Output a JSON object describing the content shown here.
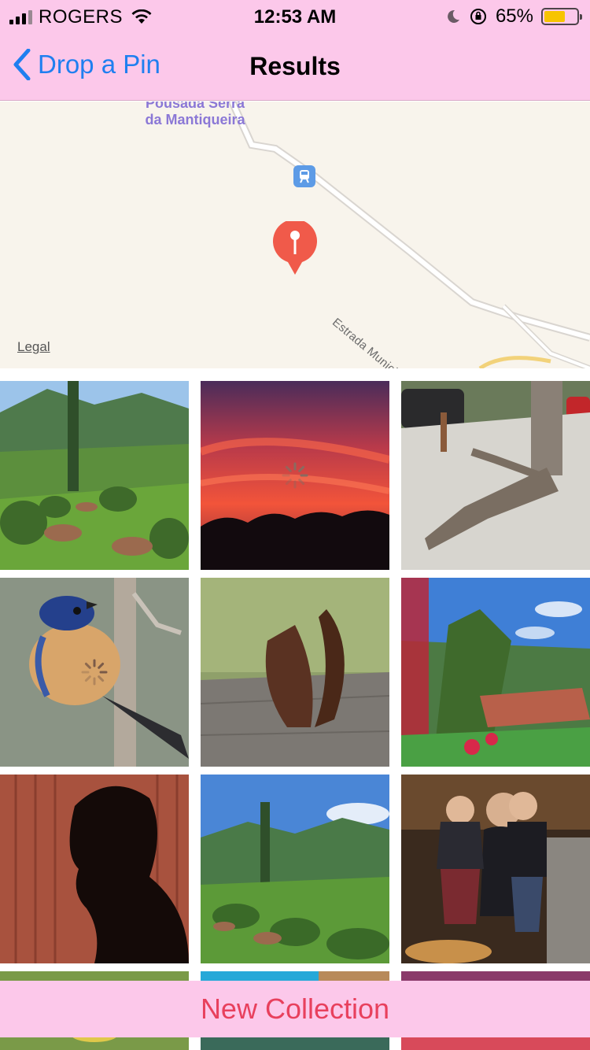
{
  "status_bar": {
    "carrier": "ROGERS",
    "time": "12:53 AM",
    "battery_percent": "65%",
    "battery_level": 0.65,
    "icons": [
      "signal-icon",
      "wifi-icon",
      "moon-icon",
      "orientation-lock-icon",
      "battery-icon"
    ]
  },
  "nav": {
    "back_label": "Drop a Pin",
    "title": "Results"
  },
  "map": {
    "poi_label": "Pousada Serra da Mantiqueira",
    "street_label": "Estrada Municipal João Jorge Saad",
    "legal_label": "Legal",
    "pin_color": "#f05a4a"
  },
  "photos": [
    {
      "subject": "mountain garden with fountains",
      "loading": false
    },
    {
      "subject": "red sunset silhouette",
      "loading": true
    },
    {
      "subject": "tree roots on sidewalk",
      "loading": false
    },
    {
      "subject": "bird on branch",
      "loading": true
    },
    {
      "subject": "dried leaf on wood",
      "loading": false
    },
    {
      "subject": "hillside with flowers and chalet",
      "loading": false
    },
    {
      "subject": "profile silhouette on curtain",
      "loading": false
    },
    {
      "subject": "garden with cypress tree",
      "loading": false
    },
    {
      "subject": "woman holding two children",
      "loading": false
    }
  ],
  "footer": {
    "new_collection_label": "New Collection"
  },
  "colors": {
    "bar_background": "#fcc8ea",
    "accent_blue": "#1f7ff0",
    "button_red": "#e8405d"
  }
}
